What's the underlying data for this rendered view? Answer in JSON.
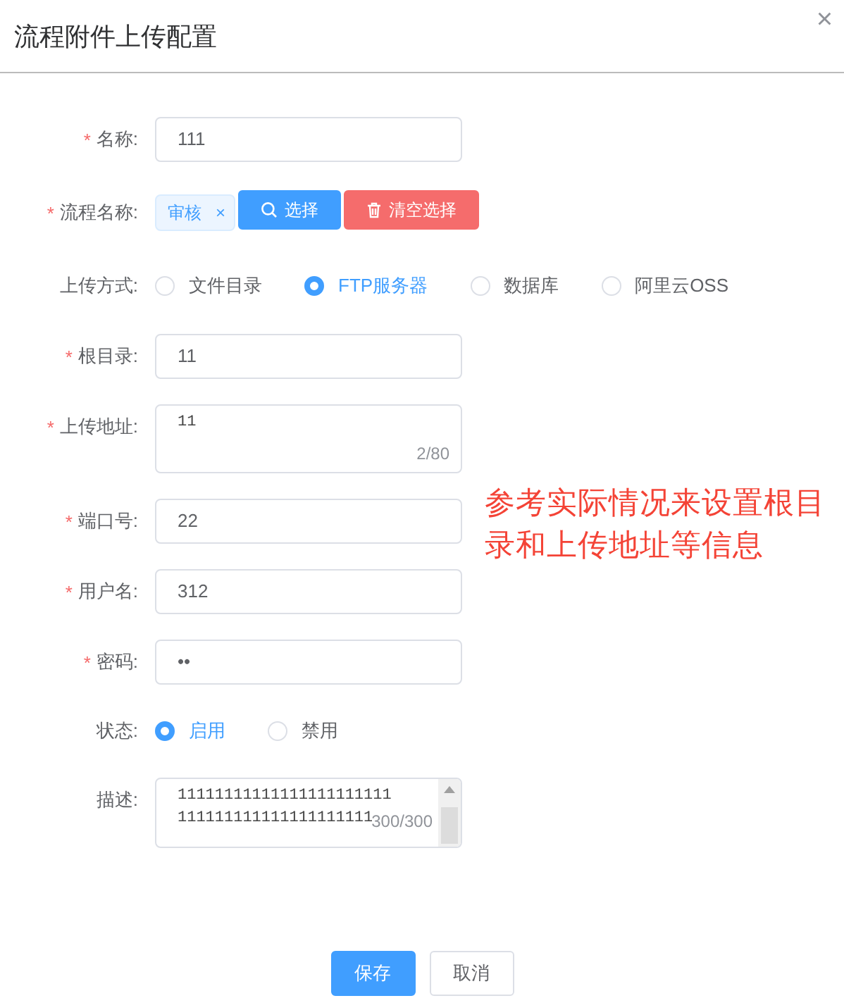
{
  "dialog": {
    "title": "流程附件上传配置",
    "close": "×"
  },
  "form": {
    "fields": [
      {
        "kind": "input",
        "label": "名称:",
        "required_mark": "*",
        "value": "111"
      },
      {
        "kind": "tagpicker",
        "label": "流程名称:",
        "required_mark": "*",
        "tag": "审核",
        "tag_close": "×",
        "buttons": [
          "选择",
          "清空选择"
        ]
      },
      {
        "kind": "radio",
        "label": "上传方式:",
        "options": [
          {
            "label": "文件目录",
            "selected": false
          },
          {
            "label": "FTP服务器",
            "selected": true
          },
          {
            "label": "数据库",
            "selected": false
          },
          {
            "label": "阿里云OSS",
            "selected": false
          }
        ]
      },
      {
        "kind": "input",
        "label": "根目录:",
        "required_mark": "*",
        "value": "11"
      },
      {
        "kind": "textarea",
        "label": "上传地址:",
        "required_mark": "*",
        "lines": [
          "11"
        ],
        "counter": "2/80"
      },
      {
        "kind": "input",
        "label": "端口号:",
        "required_mark": "*",
        "value": "22"
      },
      {
        "kind": "input",
        "label": "用户名:",
        "required_mark": "*",
        "value": "312"
      },
      {
        "kind": "input",
        "label": "密码:",
        "required_mark": "*",
        "value": "••"
      },
      {
        "kind": "radio",
        "label": "状态:",
        "options": [
          {
            "label": "启用",
            "selected": true
          },
          {
            "label": "禁用",
            "selected": false
          }
        ]
      },
      {
        "kind": "scroll_textarea",
        "label": "描述:",
        "lines": [
          "11111111111111111111111",
          "111111111111111111111"
        ],
        "counter": "300/300"
      }
    ]
  },
  "annotation": "参考实际情况来设置根目录和上传地址等信息",
  "footer": {
    "buttons": [
      "保存",
      "取消"
    ]
  }
}
